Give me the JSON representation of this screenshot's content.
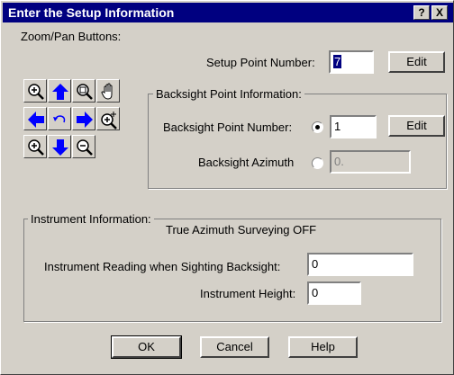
{
  "title": "Enter the Setup Information",
  "title_buttons": {
    "help": "?",
    "close": "X"
  },
  "zoom": {
    "label": "Zoom/Pan Buttons:",
    "buttons": [
      "zoom-in",
      "pan-up",
      "zoom-window",
      "pan-hand",
      "pan-left",
      "undo-zoom",
      "pan-right",
      "zoom-extents",
      "zoom-in-small",
      "pan-down",
      "zoom-out"
    ]
  },
  "setup": {
    "label": "Setup Point Number:",
    "value": "7",
    "edit_label": "Edit"
  },
  "backsight": {
    "group_title": "Backsight Point Information:",
    "point_label": "Backsight Point Number:",
    "point_value": "1",
    "point_selected": true,
    "edit_label": "Edit",
    "azimuth_label": "Backsight Azimuth",
    "azimuth_value": "0.",
    "azimuth_selected": false
  },
  "instrument": {
    "group_title": "Instrument Information:",
    "status": "True Azimuth Surveying OFF",
    "reading_label": "Instrument Reading when Sighting Backsight:",
    "reading_value": "0",
    "height_label": "Instrument Height:",
    "height_value": "0"
  },
  "footer": {
    "ok": "OK",
    "cancel": "Cancel",
    "help": "Help"
  },
  "colors": {
    "titlebar": "#000080",
    "face": "#d4d0c8",
    "arrow": "#0000ff"
  }
}
